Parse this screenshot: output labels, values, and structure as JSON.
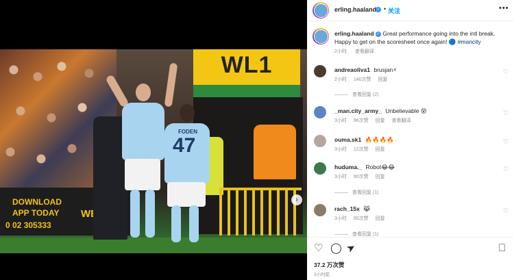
{
  "post": {
    "username": "erling.haaland",
    "follow_label": "关注",
    "separator": "•",
    "more_icon": "more-options-icon"
  },
  "photo": {
    "stadium_sign": "WL1",
    "ad_line1": "DOWNLOAD",
    "ad_line2": "APP TODAY",
    "ad_line3": "0 02 305333",
    "ad_brand": "WEB",
    "player_number": "47",
    "player_name": "FODEN",
    "next_icon": "›"
  },
  "caption": {
    "username": "erling.haaland",
    "text": "Great performance going into the intl break. Happy to get on the scoresheet once again! 🔵",
    "hashtag": "#mancity",
    "time": "2小时",
    "translate": "查看翻译"
  },
  "comments": [
    {
      "username": "andreaoliva1",
      "text": "brusjan⚡",
      "time": "2小时",
      "likes": "140次赞",
      "reply": "回复",
      "replies": "查看回复 (2)",
      "avatar_color": "#4a3b33"
    },
    {
      "username": "_man.city_army_",
      "text": "Unbelievable 😵",
      "time": "3小时",
      "likes": "96次赞",
      "reply": "回复",
      "translate": "查看翻译",
      "avatar_color": "#5a86c2"
    },
    {
      "username": "ouma.sk1",
      "text": "🔥🔥🔥🔥",
      "time": "3小时",
      "likes": "12次赞",
      "reply": "回复",
      "avatar_color": "#b7a6a0"
    },
    {
      "username": "huduma._",
      "text": "Robot😂😂",
      "time": "3小时",
      "likes": "80次赞",
      "reply": "回复",
      "replies": "查看回复 (1)",
      "avatar_color": "#3d7a4a"
    },
    {
      "username": "rach_15x",
      "text": "😹",
      "time": "3小时",
      "likes": "55次赞",
      "reply": "回复",
      "replies": "查看回复 (1)",
      "avatar_color": "#8a7a6a"
    }
  ],
  "actions": {
    "likes": "37.2 万次赞",
    "time": "3小时前",
    "like_icon": "♡",
    "comment_icon": "◯",
    "share_icon": "➤",
    "save_icon": "⎕",
    "heart_icon": "♡"
  },
  "colors": {
    "accent": "#0095f6",
    "verified": "#3897f0",
    "muted": "#8e8e8e",
    "hashtag": "#00376b"
  }
}
